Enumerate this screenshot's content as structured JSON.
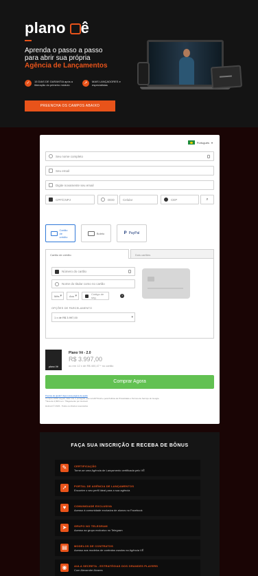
{
  "hero": {
    "brand": "plano",
    "brand_suffix": "ê",
    "headline_line1": "Aprenda o passo a passo",
    "headline_line2": "para abrir sua própria",
    "headline_highlight": "Agência de Lançamentos",
    "badge1": "15 DIAS DE GARANTIA após a liberação do primeiro módulo",
    "badge2": "MAIS LANÇADORES e especialistas",
    "cta": "PREENCHA OS CAMPOS ABAIXO",
    "laptop_label": "planoVê"
  },
  "form": {
    "language": "Português",
    "fullname_placeholder": "Seu nome completo",
    "email_placeholder": "Seu email",
    "email_confirm_placeholder": "Digite novamente seu email",
    "cpf_placeholder": "CPF/CNPJ",
    "ddd_placeholder": "DDD",
    "phone_placeholder": "Celular",
    "cep_placeholder": "CEP",
    "pay_card": "Cartão de crédito",
    "pay_boleto": "Boleto",
    "pay_paypal": "PayPal",
    "tab_card": "Cartão de crédito",
    "tab_two_cards": "Dois cartões",
    "card_number": "Número do cartão",
    "card_holder": "Nome do titular como no cartão",
    "month": "Mês",
    "year": "Ano",
    "cvv": "Código de seg.",
    "installments_label": "OPÇÕES DE PARCELAMENTO",
    "installments_value": "1 x de R$ 3.997,00"
  },
  "product": {
    "thumb": "plano Vê",
    "name": "Plano Vê - 2.0",
    "price": "R$ 3.997,00",
    "installments": "ou em 12 x de R$ 400,47 * no cartão",
    "buy_label": "Comprar Agora"
  },
  "legal": {
    "line1": "Precisa de ajuda? Veja nossa página de ajuda",
    "line2": "Compra 100% segura, Este site é protegido pelo reCAPTCHA e pela Política de Privacidade e Termos de Serviço do Google.",
    "line3": "*Taxa de 2,99% a.m. *Pagamento por Hotmart",
    "line4": "Hotmart © 2023 - Todos os direitos reservados"
  },
  "bonus": {
    "title": "FAÇA SUA INSCRIÇÃO E RECEBA DE BÔNUS",
    "items": [
      {
        "title": "CERTIFICAÇÃO",
        "desc": "Torne-se uma Agência de Lançamento certificada pelo VÊ",
        "icon": "certificate-icon",
        "glyph": "✎"
      },
      {
        "title": "PORTAL DE AGÊNCIA DE LANÇAMENTOS",
        "desc": "Encontre o seu perfil ideal para a sua agência",
        "icon": "rocket-icon",
        "glyph": "➚"
      },
      {
        "title": "COMUNIDADE EXCLUSIVA",
        "desc": "Acesso à comunidade exclusiva de alunos no Facebook",
        "icon": "thumb-icon",
        "glyph": "♥"
      },
      {
        "title": "GRUPO NO TELEGRAM",
        "desc": "Acesso ao grupo exclusivo no Telegram",
        "icon": "telegram-icon",
        "glyph": "➤"
      },
      {
        "title": "MODELOS DE CONTRATOS",
        "desc": "Acesso aos modelos de contratos usados na Agência VÊ",
        "icon": "document-icon",
        "glyph": "▤"
      },
      {
        "title": "AULA SECRETA - ESTRATÉGIAS DOS GRANDES PLAYERS",
        "desc": "Com Alexandre Alvares",
        "icon": "secret-icon",
        "glyph": "◉"
      }
    ]
  },
  "colors": {
    "accent": "#e8531a",
    "buy": "#62c152",
    "selected": "#2f78d8"
  }
}
